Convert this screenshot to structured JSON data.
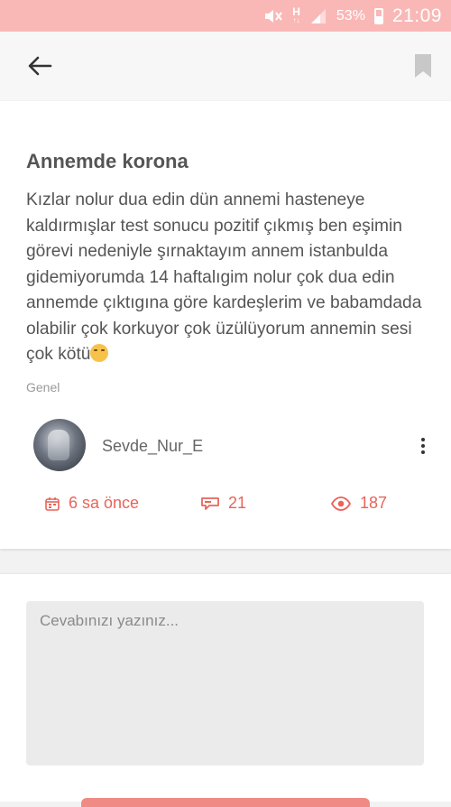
{
  "status_bar": {
    "network": "H",
    "battery_percent": "53%",
    "time": "21:09",
    "background": "#f9b8b6"
  },
  "app_bar": {
    "back_icon": "arrow-left-icon",
    "bookmark_icon": "bookmark-icon"
  },
  "post": {
    "title": "Annemde korona",
    "body": "Kızlar nolur dua edin dün annemi hasteneye kaldırmışlar test sonucu pozitif çıkmış ben eşimin  görevi nedeniyle şırnaktayım annem istanbulda gidemiyorumda 14 haftalıgim nolur çok dua edin annemde çıktıgına göre kardeşlerim ve babamdada olabilir çok korkuyor çok üzülüyorum annemin sesi çok kötü",
    "body_emoji": "worried-face-emoji",
    "category": "Genel",
    "author": {
      "username": "Sevde_Nur_E"
    },
    "stats": {
      "time_ago": "6 sa önce",
      "comments": "21",
      "views": "187"
    }
  },
  "reply": {
    "placeholder": "Cevabınızı yazınız..."
  },
  "colors": {
    "accent": "#e8645a",
    "title_text": "#555555",
    "muted_text": "#999999"
  }
}
